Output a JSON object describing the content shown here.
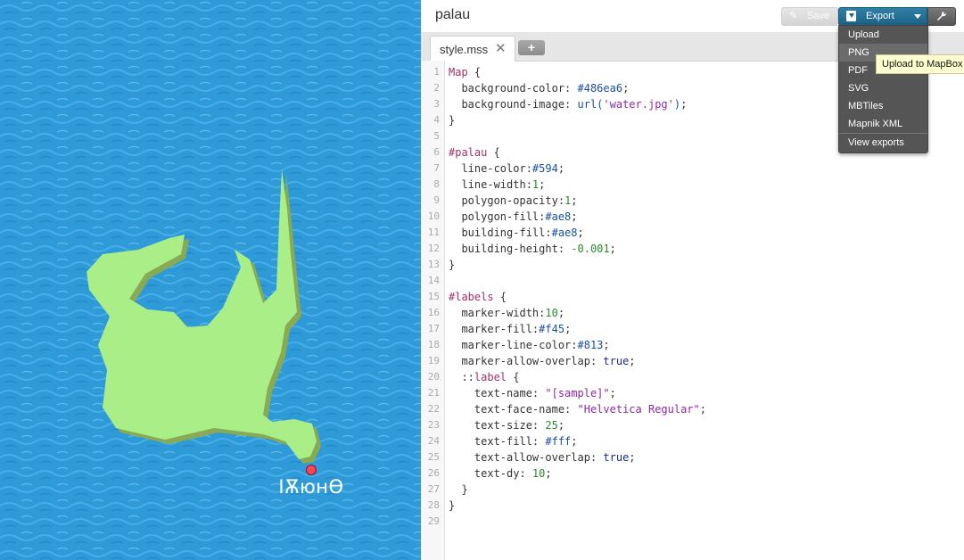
{
  "map": {
    "label": "ІѪюнѲ",
    "colors": {
      "water": "#2f9ad8",
      "land": "#aaee88",
      "land_shadow": "#88aa55",
      "marker": "#ff4455"
    }
  },
  "editor": {
    "project_title": "palau",
    "tabs": [
      {
        "label": "style.mss",
        "close": "✕"
      }
    ],
    "add_tab_label": "+",
    "toolbar": {
      "save_label": "Save",
      "export_label": "Export",
      "tools_icon": "wrench-icon"
    },
    "export_menu": {
      "items": [
        "Upload",
        "PNG",
        "PDF",
        "SVG",
        "MBTiles",
        "Mapnik XML"
      ],
      "footer": "View exports"
    },
    "tooltip": "Upload to MapBox",
    "line_numbers": [
      "1",
      "2",
      "3",
      "4",
      "5",
      "6",
      "7",
      "8",
      "9",
      "10",
      "11",
      "12",
      "13",
      "14",
      "15",
      "16",
      "17",
      "18",
      "19",
      "20",
      "21",
      "22",
      "23",
      "24",
      "25",
      "26",
      "27",
      "28",
      "29"
    ]
  }
}
